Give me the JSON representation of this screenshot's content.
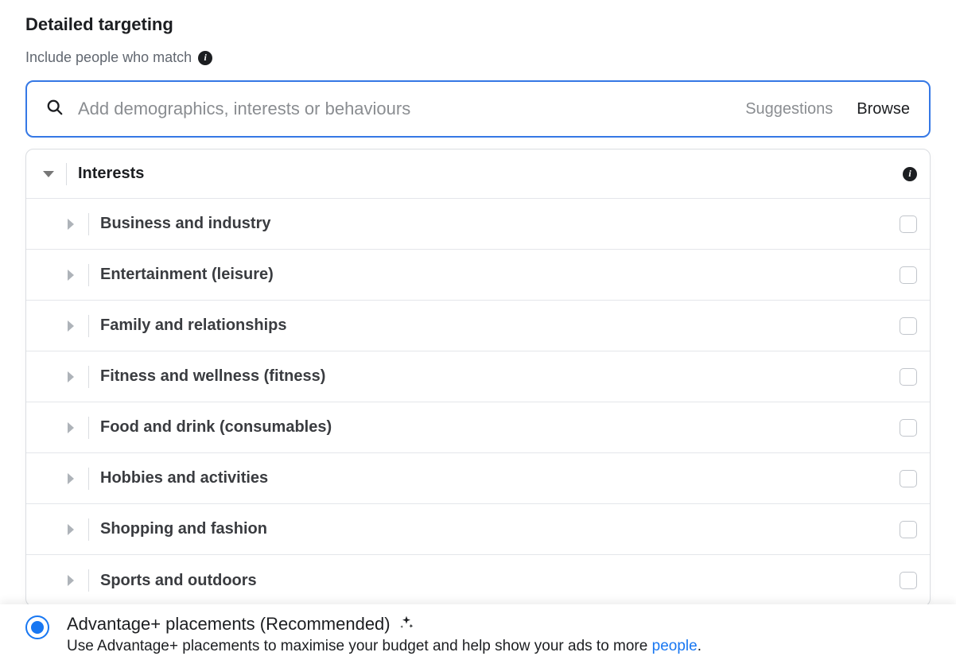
{
  "title": "Detailed targeting",
  "subtitle": "Include people who match",
  "search": {
    "placeholder": "Add demographics, interests or behaviours",
    "suggestions_label": "Suggestions",
    "browse_label": "Browse"
  },
  "interests": {
    "header": "Interests",
    "categories": [
      "Business and industry",
      "Entertainment (leisure)",
      "Family and relationships",
      "Fitness and wellness (fitness)",
      "Food and drink (consumables)",
      "Hobbies and activities",
      "Shopping and fashion",
      "Sports and outdoors"
    ]
  },
  "placements": {
    "title": "Advantage+ placements (Recommended)",
    "description_prefix": "Use Advantage+ placements to maximise your budget and help show your ads to more ",
    "description_link": "people",
    "description_suffix": "."
  }
}
